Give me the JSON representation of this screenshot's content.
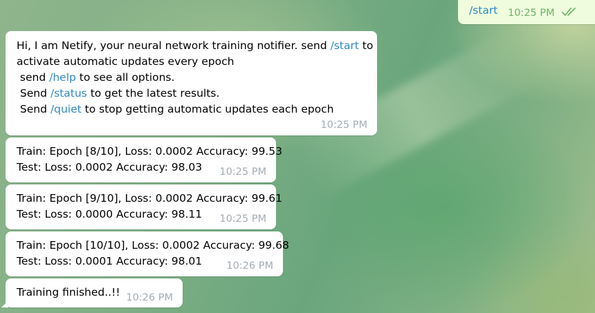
{
  "outgoing": {
    "command": "/start",
    "time": "10:25 PM"
  },
  "messages": [
    {
      "lines": [
        [
          {
            "t": "Hi, I am Netify, your neural network training notifier. send "
          },
          {
            "t": "/start",
            "cmd": true
          },
          {
            "t": " to"
          }
        ],
        [
          {
            "t": "activate automatic updates every epoch"
          }
        ],
        [
          {
            "t": " send "
          },
          {
            "t": "/help",
            "cmd": true
          },
          {
            "t": " to see all options."
          }
        ],
        [
          {
            "t": " Send "
          },
          {
            "t": "/status",
            "cmd": true
          },
          {
            "t": " to get the latest results."
          }
        ],
        [
          {
            "t": " Send "
          },
          {
            "t": "/quiet",
            "cmd": true
          },
          {
            "t": " to stop getting automatic updates each epoch"
          }
        ]
      ],
      "time": "10:25 PM"
    },
    {
      "lines": [
        [
          {
            "t": "Train: Epoch [8/10], Loss: 0.0002 Accuracy: 99.53"
          }
        ],
        [
          {
            "t": "Test: Loss: 0.0002 Accuracy: 98.03"
          }
        ]
      ],
      "time": "10:25 PM"
    },
    {
      "lines": [
        [
          {
            "t": "Train: Epoch [9/10], Loss: 0.0002 Accuracy: 99.61"
          }
        ],
        [
          {
            "t": "Test: Loss: 0.0000 Accuracy: 98.11"
          }
        ]
      ],
      "time": "10:25 PM"
    },
    {
      "lines": [
        [
          {
            "t": "Train: Epoch [10/10], Loss: 0.0002 Accuracy: 99.68"
          }
        ],
        [
          {
            "t": "Test: Loss: 0.0001 Accuracy: 98.01"
          }
        ]
      ],
      "time": "10:26 PM"
    },
    {
      "lines": [
        [
          {
            "t": "Training finished..!!"
          }
        ]
      ],
      "time": "10:26 PM"
    }
  ],
  "colors": {
    "command_link": "#2f8ac4",
    "outgoing_bubble": "#effdde",
    "incoming_bubble": "#ffffff",
    "timestamp_incoming": "#a2acb4",
    "timestamp_outgoing": "#6db564"
  },
  "icons": {
    "read_status": "double-check-icon"
  }
}
